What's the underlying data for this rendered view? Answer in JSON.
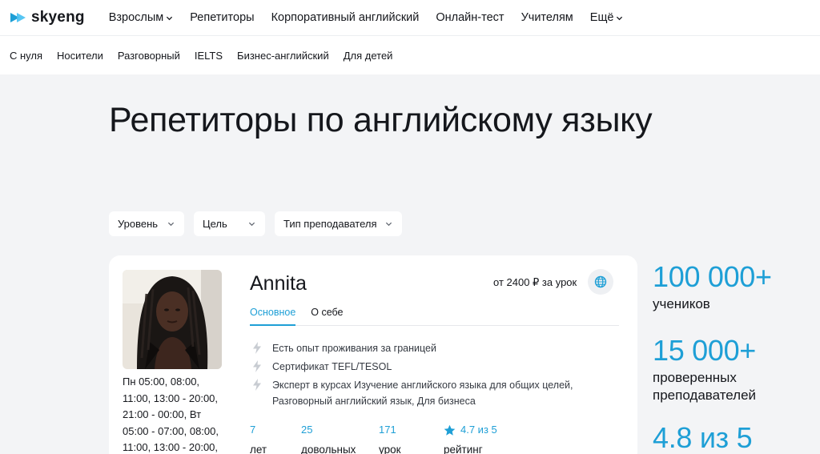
{
  "header": {
    "logo_text": "skyeng",
    "nav": [
      {
        "label": "Взрослым",
        "has_chevron": true
      },
      {
        "label": "Репетиторы",
        "has_chevron": false
      },
      {
        "label": "Корпоративный английский",
        "has_chevron": false
      },
      {
        "label": "Онлайн-тест",
        "has_chevron": false
      },
      {
        "label": "Учителям",
        "has_chevron": false
      },
      {
        "label": "Ещё",
        "has_chevron": true
      }
    ]
  },
  "subnav": [
    "С нуля",
    "Носители",
    "Разговорный",
    "IELTS",
    "Бизнес-английский",
    "Для детей"
  ],
  "page": {
    "title": "Репетиторы по английскому языку"
  },
  "filters": [
    {
      "label": "Уровень"
    },
    {
      "label": "Цель"
    },
    {
      "label": "Тип преподавателя"
    }
  ],
  "tutor": {
    "name": "Annita",
    "price": "от 2400 ₽ за урок",
    "schedule": "Пн 05:00, 08:00, 11:00, 13:00 - 20:00, 21:00 - 00:00, Вт 05:00 - 07:00, 08:00, 11:00, 13:00 - 20:00,",
    "tabs": [
      "Основное",
      "О себе"
    ],
    "features": [
      "Есть опыт проживания за границей",
      "Сертификат TEFL/TESOL",
      "Эксперт в курсах Изучение английского языка для общих целей, Разговорный английский язык, Для бизнеса"
    ],
    "stats": [
      {
        "value": "7",
        "label": "лет"
      },
      {
        "value": "25",
        "label": "довольных"
      },
      {
        "value": "171",
        "label": "урок"
      },
      {
        "value": "4.7 из 5",
        "label": "рейтинг"
      }
    ]
  },
  "side_stats": [
    {
      "value": "100 000+",
      "label": "учеников"
    },
    {
      "value": "15 000+",
      "label": "проверенных преподавателей"
    },
    {
      "value": "4.8 из 5",
      "label": ""
    }
  ],
  "colors": {
    "accent": "#1e9fd6",
    "background": "#f3f4f6",
    "text": "#15171c"
  },
  "icons": [
    "skyeng-logo-icon",
    "chevron-down-icon",
    "globe-icon",
    "lightning-icon",
    "star-icon"
  ]
}
